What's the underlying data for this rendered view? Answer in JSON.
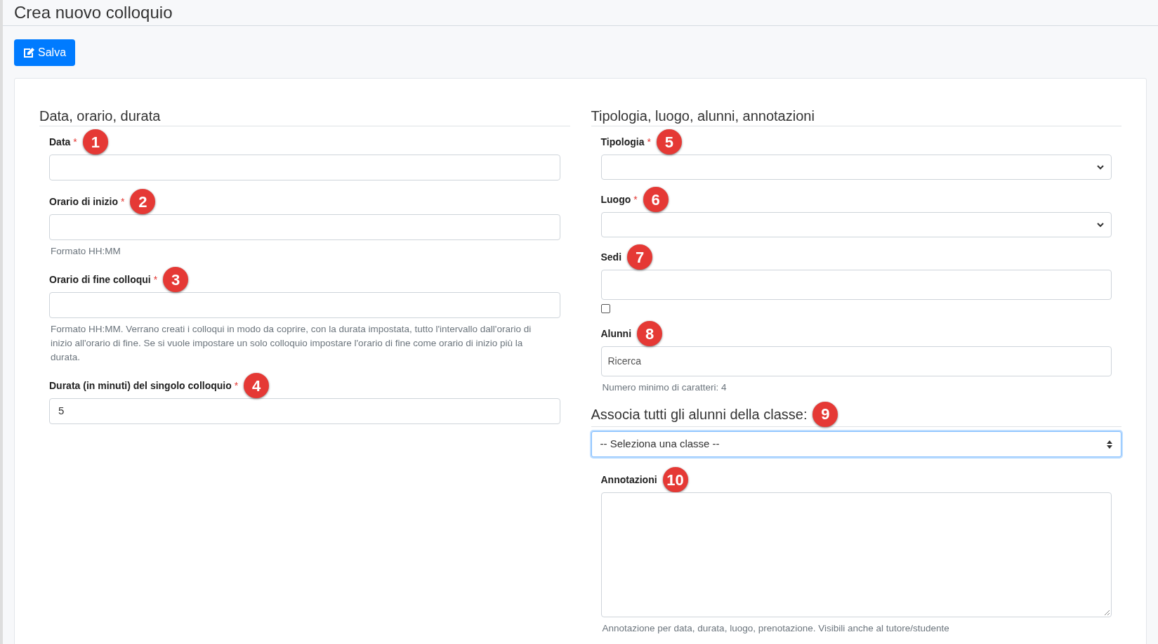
{
  "page": {
    "title": "Crea nuovo colloquio"
  },
  "toolbar": {
    "save_button": "Salva"
  },
  "columns": [
    {
      "title": "Data, orario, durata",
      "fields": [
        {
          "kind": "text",
          "label": "Data",
          "required_mark": "*",
          "badge": "1"
        },
        {
          "kind": "text",
          "label": "Orario di inizio",
          "required_mark": "*",
          "badge": "2",
          "help": "Formato HH:MM"
        },
        {
          "kind": "text",
          "label": "Orario di fine colloqui",
          "required_mark": "*",
          "badge": "3",
          "help": "Formato HH:MM. Verrano creati i colloqui in modo da coprire, con la durata impostata, tutto l'intervallo dall'orario di inizio all'orario di fine. Se si vuole impostare un solo colloquio impostare l'orario di fine come orario di inizio più la durata."
        },
        {
          "kind": "text",
          "label": "Durata (in minuti) del singolo colloquio",
          "required_mark": "*",
          "badge": "4",
          "value": "5"
        }
      ]
    },
    {
      "title": "Tipologia, luogo, alunni, annotazioni",
      "fields": [
        {
          "kind": "select",
          "label": "Tipologia",
          "required_mark": "*",
          "badge": "5"
        },
        {
          "kind": "select",
          "label": "Luogo",
          "required_mark": "*",
          "badge": "6"
        },
        {
          "kind": "tags",
          "label": "Sedi",
          "badge": "7",
          "checked": false
        },
        {
          "kind": "tags",
          "label": "Alunni",
          "badge": "8",
          "placeholder": "Ricerca",
          "help": "Numero minimo di caratteri: 4"
        },
        {
          "kind": "heading",
          "label": "Associa tutti gli alunni della classe:",
          "badge": "9"
        },
        {
          "kind": "native-select",
          "value": "-- Seleziona una classe --",
          "focused": true
        },
        {
          "kind": "textarea",
          "label": "Annotazioni",
          "badge": "10",
          "help": "Annotazione per data, durata, luogo, prenotazione. Visibili anche al tutore/studente"
        }
      ]
    }
  ]
}
